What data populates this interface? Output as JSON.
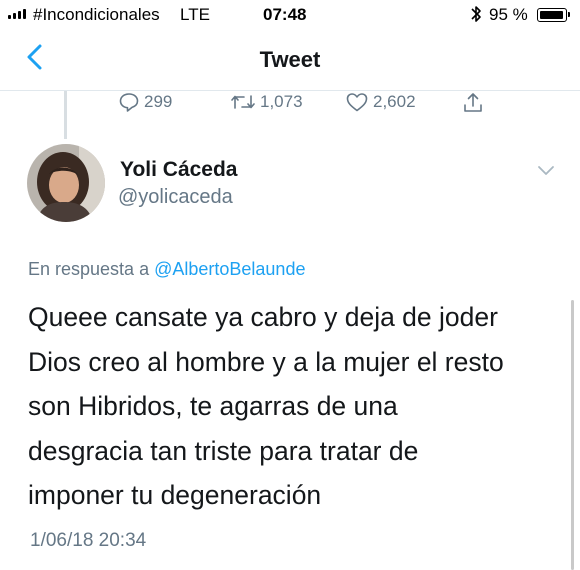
{
  "status_bar": {
    "carrier": "#Incondicionales",
    "network": "LTE",
    "time": "07:48",
    "battery": "95 %",
    "bluetooth_icon": "bluetooth-icon"
  },
  "nav": {
    "title": "Tweet",
    "back_icon": "chevron-left-icon"
  },
  "previous_tweet": {
    "reply_count": "299",
    "retweet_count": "1,073",
    "like_count": "2,602"
  },
  "tweet": {
    "author_name": "Yoli Cáceda",
    "author_handle": "@yolicaceda",
    "reply_prefix": "En respuesta a ",
    "reply_to": "@AlbertoBelaunde",
    "text_lines": [
      "Queee cansate ya cabro y deja de joder",
      "Dios creo al hombre y a la mujer el resto",
      "son Hibridos, te agarras de una",
      "desgracia tan triste para tratar de",
      "imponer tu degeneración"
    ],
    "timestamp": "1/06/18 20:34"
  },
  "colors": {
    "accent": "#1da1f2",
    "muted": "#657786",
    "text": "#14171a"
  }
}
